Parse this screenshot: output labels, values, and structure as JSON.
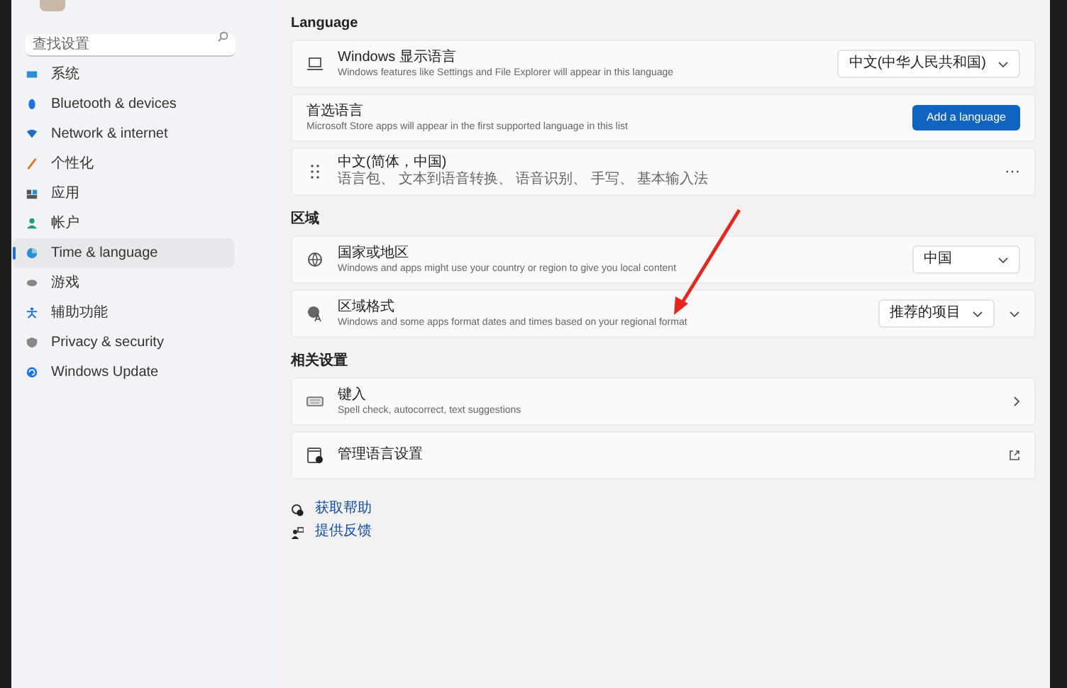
{
  "sidebar": {
    "search": {
      "placeholder": "查找设置"
    },
    "items": [
      {
        "label": "系统",
        "selected": false
      },
      {
        "label": "Bluetooth & devices",
        "selected": false
      },
      {
        "label": "Network & internet",
        "selected": false
      },
      {
        "label": "个性化",
        "selected": false
      },
      {
        "label": "应用",
        "selected": false
      },
      {
        "label": "帐户",
        "selected": false
      },
      {
        "label": "Time & language",
        "selected": true
      },
      {
        "label": "游戏",
        "selected": false
      },
      {
        "label": "辅助功能",
        "selected": false
      },
      {
        "label": "Privacy & security",
        "selected": false
      },
      {
        "label": "Windows Update",
        "selected": false
      }
    ]
  },
  "sections": [
    {
      "heading": "Language",
      "rows": [
        {
          "kind": "dropdown",
          "title": "Windows 显示语言",
          "description": "Windows features like Settings and File Explorer will appear in this language",
          "value": "中文(中华人民共和国)"
        },
        {
          "kind": "button",
          "title": "首选语言",
          "description": "Microsoft Store apps will appear in the first supported language in this list",
          "button": "Add a language"
        },
        {
          "kind": "more",
          "title": "中文(简体，中国)",
          "description": "语言包、 文本到语音转换、 语音识别、 手写、 基本输入法",
          "more": "···"
        }
      ]
    },
    {
      "heading": "区域",
      "rows": [
        {
          "kind": "dropdown",
          "title": "国家或地区",
          "description": "Windows and apps might use your country or region to give you local content",
          "value": "中国"
        },
        {
          "kind": "dropdown",
          "title": "区域格式",
          "description": "Windows and some apps format dates and times based on your regional format",
          "value": "推荐的项目",
          "expanded": false
        }
      ]
    },
    {
      "heading": "相关设置",
      "rows": [
        {
          "kind": "link",
          "title": "键入",
          "description": "Spell check, autocorrect, text suggestions"
        },
        {
          "kind": "external",
          "title": "管理语言设置"
        }
      ]
    }
  ],
  "help_links": [
    "获取帮助",
    "提供反馈"
  ]
}
